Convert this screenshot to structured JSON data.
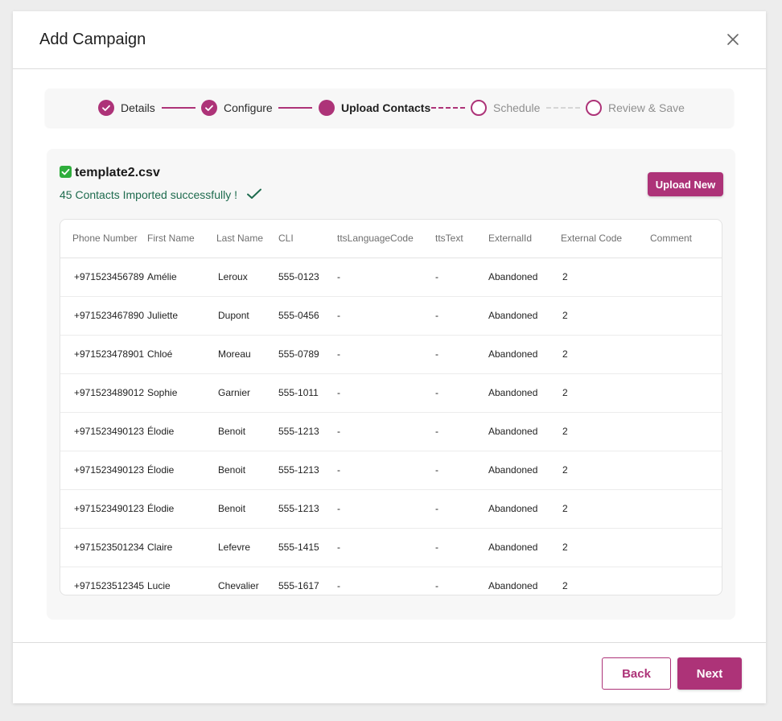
{
  "modal": {
    "title": "Add Campaign",
    "close_icon": "close-icon"
  },
  "stepper": {
    "steps": [
      {
        "label": "Details",
        "state": "done"
      },
      {
        "label": "Configure",
        "state": "done"
      },
      {
        "label": "Upload Contacts",
        "state": "active"
      },
      {
        "label": "Schedule",
        "state": "todo"
      },
      {
        "label": "Review & Save",
        "state": "todo"
      }
    ]
  },
  "upload": {
    "file_name": "template2.csv",
    "file_icon": "checkbox-checked-icon",
    "status_message": "45 Contacts Imported successfully !",
    "status_icon": "checkmark-icon",
    "upload_new_label": "Upload New"
  },
  "table": {
    "columns": [
      "Phone Number",
      "First Name",
      "Last Name",
      "CLI",
      "ttsLanguageCode",
      "ttsText",
      "ExternalId",
      "External Code",
      "Comment"
    ],
    "rows": [
      [
        "+971523456789",
        "Amélie",
        "Leroux",
        "555-0123",
        "-",
        "-",
        "Abandoned",
        "2",
        ""
      ],
      [
        "+971523467890",
        "Juliette",
        "Dupont",
        "555-0456",
        "-",
        "-",
        "Abandoned",
        "2",
        ""
      ],
      [
        "+971523478901",
        "Chloé",
        "Moreau",
        "555-0789",
        "-",
        "-",
        "Abandoned",
        "2",
        ""
      ],
      [
        "+971523489012",
        "Sophie",
        "Garnier",
        "555-1011",
        "-",
        "-",
        "Abandoned",
        "2",
        ""
      ],
      [
        "+971523490123",
        "Élodie",
        "Benoit",
        "555-1213",
        "-",
        "-",
        "Abandoned",
        "2",
        ""
      ],
      [
        "+971523490123",
        "Élodie",
        "Benoit",
        "555-1213",
        "-",
        "-",
        "Abandoned",
        "2",
        ""
      ],
      [
        "+971523490123",
        "Élodie",
        "Benoit",
        "555-1213",
        "-",
        "-",
        "Abandoned",
        "2",
        ""
      ],
      [
        "+971523501234",
        "Claire",
        "Lefevre",
        "555-1415",
        "-",
        "-",
        "Abandoned",
        "2",
        ""
      ],
      [
        "+971523512345",
        "Lucie",
        "Chevalier",
        "555-1617",
        "-",
        "-",
        "Abandoned",
        "2",
        ""
      ]
    ]
  },
  "footer": {
    "back_label": "Back",
    "next_label": "Next"
  },
  "colors": {
    "accent": "#ad3378",
    "success_text": "#1e6b4e",
    "success_check": "#2fad3c"
  }
}
